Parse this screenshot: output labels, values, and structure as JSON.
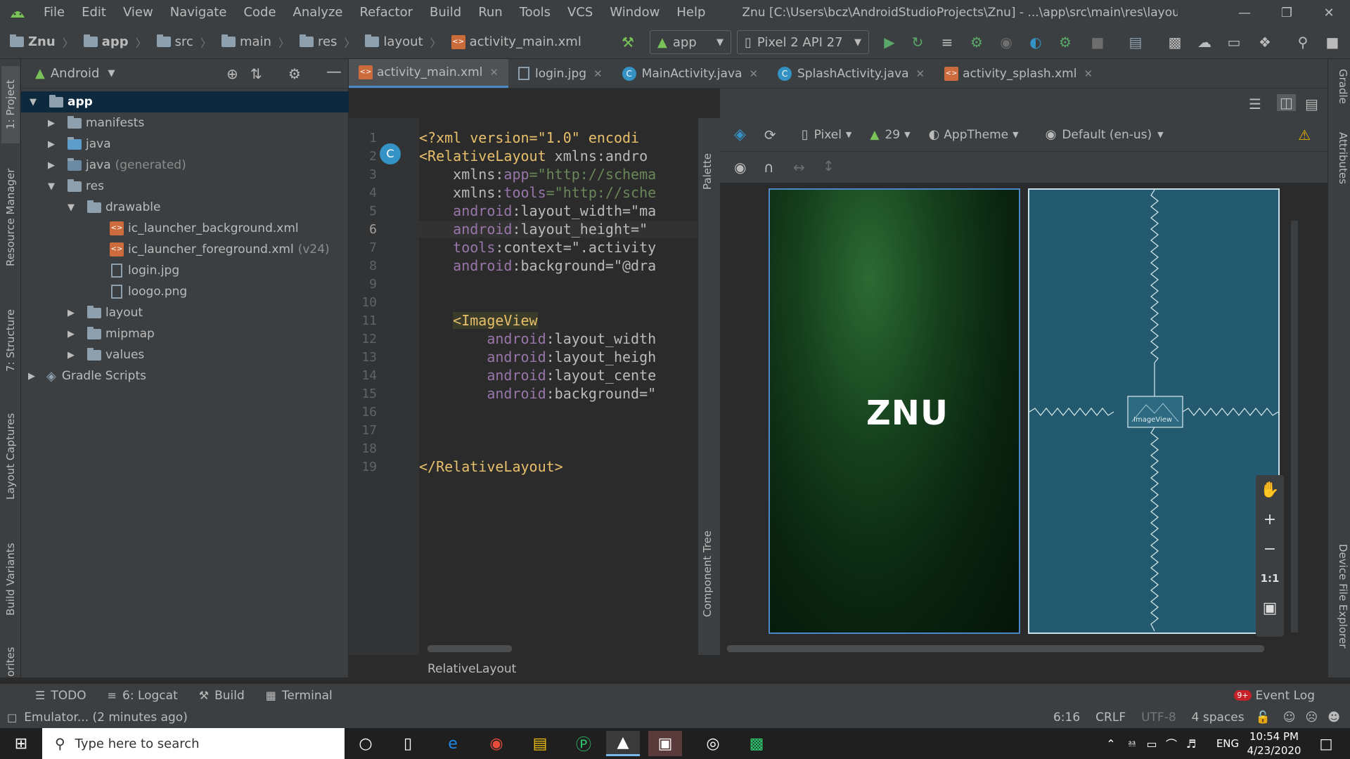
{
  "menu": {
    "items": [
      "File",
      "Edit",
      "View",
      "Navigate",
      "Code",
      "Analyze",
      "Refactor",
      "Build",
      "Run",
      "Tools",
      "VCS",
      "Window",
      "Help"
    ],
    "title": "Znu [C:\\Users\\bcz\\AndroidStudioProjects\\Znu] - ...\\app\\src\\main\\res\\layout\\activity_main.xml [a"
  },
  "nav": {
    "crumbs": [
      "Znu",
      "app",
      "src",
      "main",
      "res",
      "layout",
      "activity_main.xml"
    ],
    "run_config": "app",
    "device": "Pixel 2 API 27"
  },
  "left_stripe": [
    "1: Project",
    "Resource Manager",
    "7: Structure",
    "Layout Captures",
    "Build Variants",
    "orites"
  ],
  "right_stripe": [
    "Gradle",
    "Attributes",
    "Device File Explorer"
  ],
  "project": {
    "view": "Android",
    "tree": [
      {
        "label": "app",
        "arrow": "▼"
      },
      {
        "label": "manifests",
        "arrow": "▶"
      },
      {
        "label": "java",
        "arrow": "▶"
      },
      {
        "label": "java",
        "muted": "(generated)",
        "arrow": "▶"
      },
      {
        "label": "res",
        "arrow": "▼"
      },
      {
        "label": "drawable",
        "arrow": "▼"
      },
      {
        "label": "ic_launcher_background.xml"
      },
      {
        "label": "ic_launcher_foreground.xml",
        "muted": "(v24)"
      },
      {
        "label": "login.jpg"
      },
      {
        "label": "loogo.png"
      },
      {
        "label": "layout",
        "arrow": "▶"
      },
      {
        "label": "mipmap",
        "arrow": "▶"
      },
      {
        "label": "values",
        "arrow": "▶"
      },
      {
        "label": "Gradle Scripts",
        "arrow": "▶"
      }
    ]
  },
  "tabs": [
    "activity_main.xml",
    "login.jpg",
    "MainActivity.java",
    "SplashActivity.java",
    "activity_splash.xml"
  ],
  "code": {
    "line_numbers": [
      "1",
      "2",
      "3",
      "4",
      "5",
      "6",
      "7",
      "8",
      "9",
      "10",
      "11",
      "12",
      "13",
      "14",
      "15",
      "16",
      "17",
      "18",
      "19"
    ],
    "l1_a": "<?xml version=\"1.0\" encodi",
    "l2_tag": "<RelativeLayout",
    "l2_rest": " xmlns:andro",
    "l3_ns": "xmlns:",
    "l3_attr": "app",
    "l3_val": "=\"http://schema",
    "l4_ns": "xmlns:",
    "l4_attr": "tools",
    "l4_val": "=\"http://sche",
    "l5_ns": "android",
    "l5_attr": ":layout_width=\"ma",
    "l6_ns": "android",
    "l6_attr": ":layout_height=\"",
    "l7_ns": "tools",
    "l7_attr": ":context=\".activity",
    "l8_ns": "android",
    "l8_attr": ":background=\"@dra",
    "l11_tag": "<ImageView",
    "l12_ns": "android",
    "l12_attr": ":layout_width",
    "l13_ns": "android",
    "l13_attr": ":layout_heigh",
    "l14_ns": "android",
    "l14_attr": ":layout_cente",
    "l15_ns": "android",
    "l15_attr": ":background=\"",
    "l19_tag": "</RelativeLayout>"
  },
  "design": {
    "device": "Pixel",
    "api": "29",
    "theme": "AppTheme",
    "locale": "Default (en-us)",
    "preview_logo": "ZNU",
    "blueprint_label": "ImageView",
    "palette_label": "Palette",
    "component_tree_label": "Component Tree",
    "zoom_ratio": "1:1",
    "breadcrumb": "RelativeLayout"
  },
  "bottom": {
    "todo": "TODO",
    "logcat": "6: Logcat",
    "build": "Build",
    "terminal": "Terminal",
    "event_log": "Event Log",
    "event_badge": "9+"
  },
  "status": {
    "message": "Emulator... (2 minutes ago)",
    "position": "6:16",
    "line_sep": "CRLF",
    "encoding": "UTF-8",
    "indent": "4 spaces"
  },
  "taskbar": {
    "search_placeholder": "Type here to search",
    "lang": "ENG",
    "time": "10:54 PM",
    "date": "4/23/2020"
  }
}
